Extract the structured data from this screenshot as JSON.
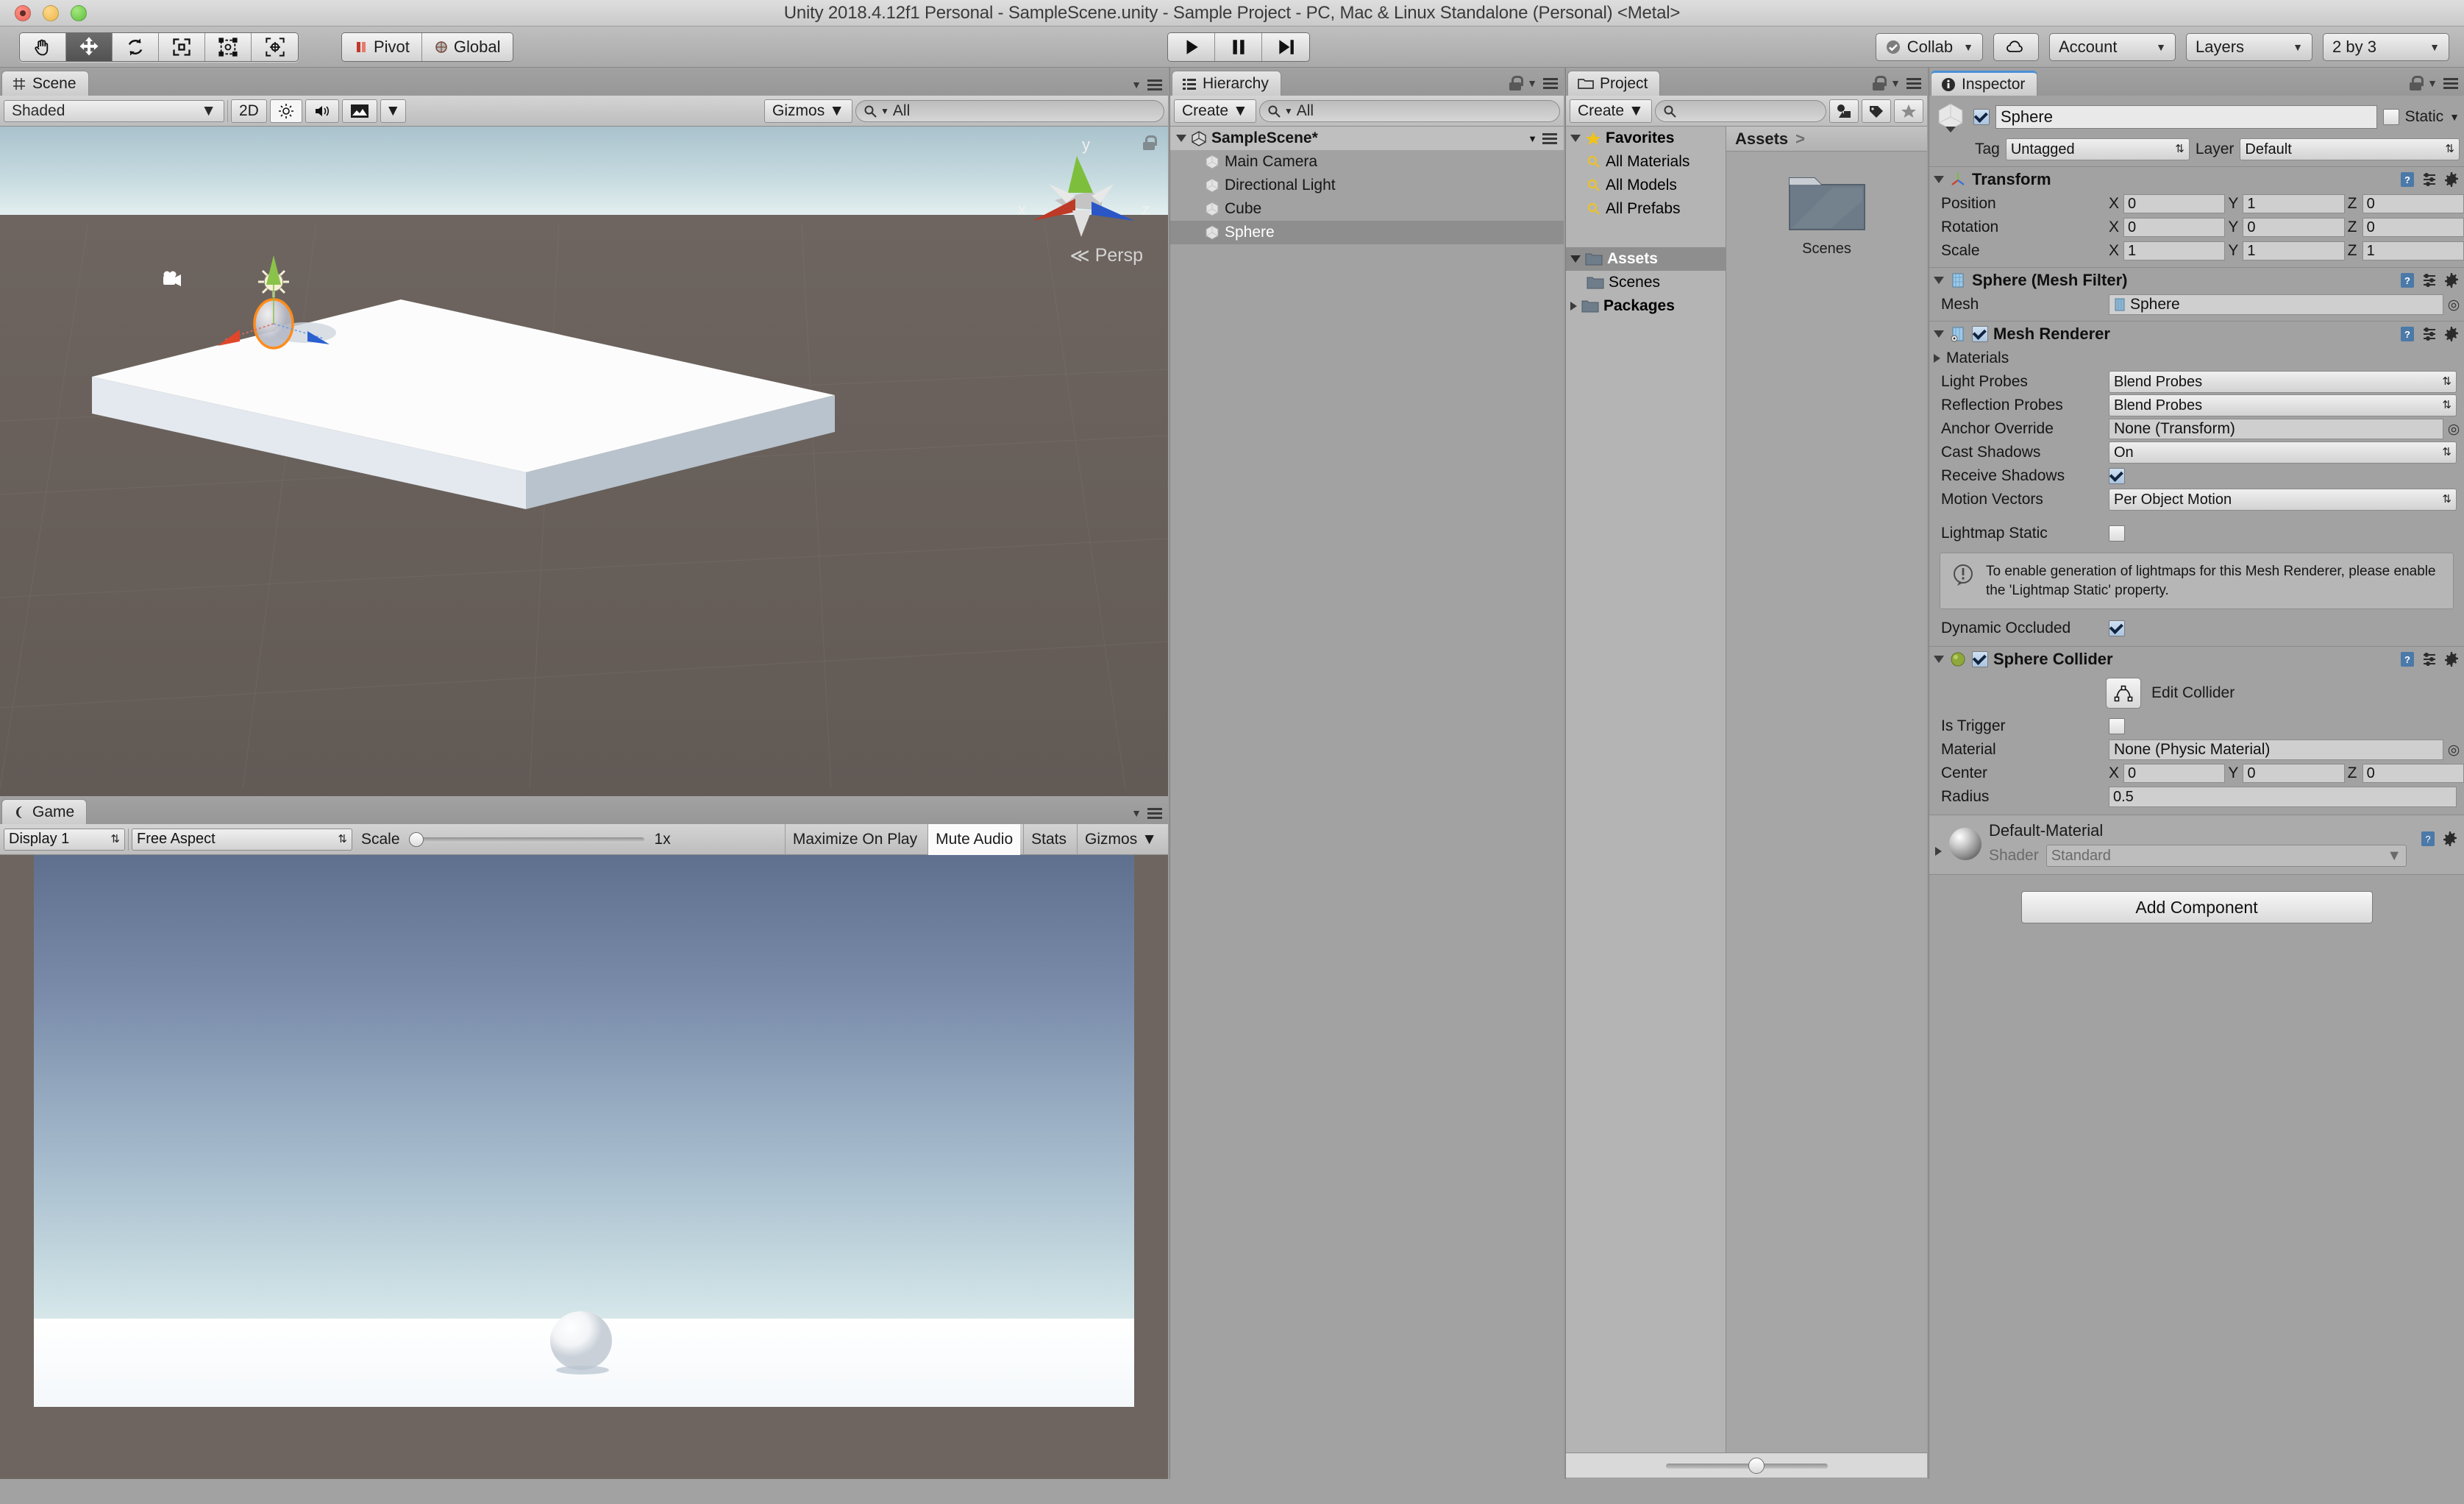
{
  "window": {
    "title": "Unity 2018.4.12f1 Personal - SampleScene.unity - Sample Project - PC, Mac & Linux Standalone (Personal) <Metal>"
  },
  "toolbar": {
    "tools": [
      {
        "name": "hand-tool",
        "selected": false
      },
      {
        "name": "move-tool",
        "selected": true
      },
      {
        "name": "rotate-tool",
        "selected": false
      },
      {
        "name": "scale-tool",
        "selected": false
      },
      {
        "name": "rect-tool",
        "selected": false
      },
      {
        "name": "transform-tool",
        "selected": false
      }
    ],
    "pivot_label": "Pivot",
    "global_label": "Global",
    "play_label": "Play",
    "pause_label": "Pause",
    "step_label": "Step",
    "collab_label": "Collab",
    "cloud_label": "Cloud",
    "account_label": "Account",
    "layers_label": "Layers",
    "layout_label": "2 by 3"
  },
  "scene": {
    "tab_label": "Scene",
    "draw_mode": "Shaded",
    "mode_2d": "2D",
    "gizmos_label": "Gizmos",
    "search_placeholder": "All",
    "search_value": "",
    "axis_x": "x",
    "axis_y": "y",
    "axis_z": "z",
    "perspective_label": "Persp"
  },
  "game": {
    "tab_label": "Game",
    "display": "Display 1",
    "aspect": "Free Aspect",
    "scale_label": "Scale",
    "scale_value": "1x",
    "maximize_label": "Maximize On Play",
    "mute_label": "Mute Audio",
    "stats_label": "Stats",
    "gizmos_label": "Gizmos"
  },
  "hierarchy": {
    "tab_label": "Hierarchy",
    "create_label": "Create",
    "search_placeholder": "All",
    "search_value": "",
    "scene_name": "SampleScene*",
    "items": [
      {
        "label": "Main Camera",
        "selected": false
      },
      {
        "label": "Directional Light",
        "selected": false
      },
      {
        "label": "Cube",
        "selected": false
      },
      {
        "label": "Sphere",
        "selected": true
      }
    ]
  },
  "project": {
    "tab_label": "Project",
    "create_label": "Create",
    "search_placeholder": "",
    "search_value": "",
    "favorites_label": "Favorites",
    "favorites": [
      "All Materials",
      "All Models",
      "All Prefabs"
    ],
    "assets_label": "Assets",
    "assets_children": [
      "Scenes"
    ],
    "packages_label": "Packages",
    "breadcrumb": "Assets",
    "breadcrumb_sep": ">",
    "tiles": [
      {
        "label": "Scenes",
        "type": "folder"
      }
    ]
  },
  "inspector": {
    "tab_label": "Inspector",
    "object_name": "Sphere",
    "enabled": true,
    "static_label": "Static",
    "static_checked": false,
    "tag_label": "Tag",
    "tag_value": "Untagged",
    "layer_label": "Layer",
    "layer_value": "Default",
    "transform": {
      "title": "Transform",
      "rows": [
        {
          "label": "Position",
          "x": "0",
          "y": "1",
          "z": "0"
        },
        {
          "label": "Rotation",
          "x": "0",
          "y": "0",
          "z": "0"
        },
        {
          "label": "Scale",
          "x": "1",
          "y": "1",
          "z": "1"
        }
      ],
      "ax_x": "X",
      "ax_y": "Y",
      "ax_z": "Z"
    },
    "mesh_filter": {
      "title": "Sphere (Mesh Filter)",
      "mesh_label": "Mesh",
      "mesh_value": "Sphere"
    },
    "mesh_renderer": {
      "title": "Mesh Renderer",
      "enabled": true,
      "materials_label": "Materials",
      "light_probes_label": "Light Probes",
      "light_probes_value": "Blend Probes",
      "reflection_probes_label": "Reflection Probes",
      "reflection_probes_value": "Blend Probes",
      "anchor_override_label": "Anchor Override",
      "anchor_override_value": "None (Transform)",
      "cast_shadows_label": "Cast Shadows",
      "cast_shadows_value": "On",
      "receive_shadows_label": "Receive Shadows",
      "receive_shadows_checked": true,
      "motion_vectors_label": "Motion Vectors",
      "motion_vectors_value": "Per Object Motion",
      "lightmap_static_label": "Lightmap Static",
      "lightmap_static_checked": false,
      "help_text": "To enable generation of lightmaps for this Mesh Renderer, please enable the 'Lightmap Static' property.",
      "dynamic_occluded_label": "Dynamic Occluded",
      "dynamic_occluded_checked": true
    },
    "sphere_collider": {
      "title": "Sphere Collider",
      "enabled": true,
      "edit_collider_label": "Edit Collider",
      "is_trigger_label": "Is Trigger",
      "is_trigger_checked": false,
      "material_label": "Material",
      "material_value": "None (Physic Material)",
      "center_label": "Center",
      "center_x": "0",
      "center_y": "0",
      "center_z": "0",
      "radius_label": "Radius",
      "radius_value": "0.5"
    },
    "material": {
      "title": "Default-Material",
      "shader_label": "Shader",
      "shader_value": "Standard"
    },
    "add_component_label": "Add Component"
  },
  "colors": {
    "accent_blue": "#4a90d9",
    "panel_bg": "#a2a2a2",
    "toolbar_bg": "#b4b4b4",
    "selection": "#8e8e8e",
    "axis_x": "#d9432e",
    "axis_y": "#8bc34a",
    "axis_z": "#2a5fd0"
  }
}
